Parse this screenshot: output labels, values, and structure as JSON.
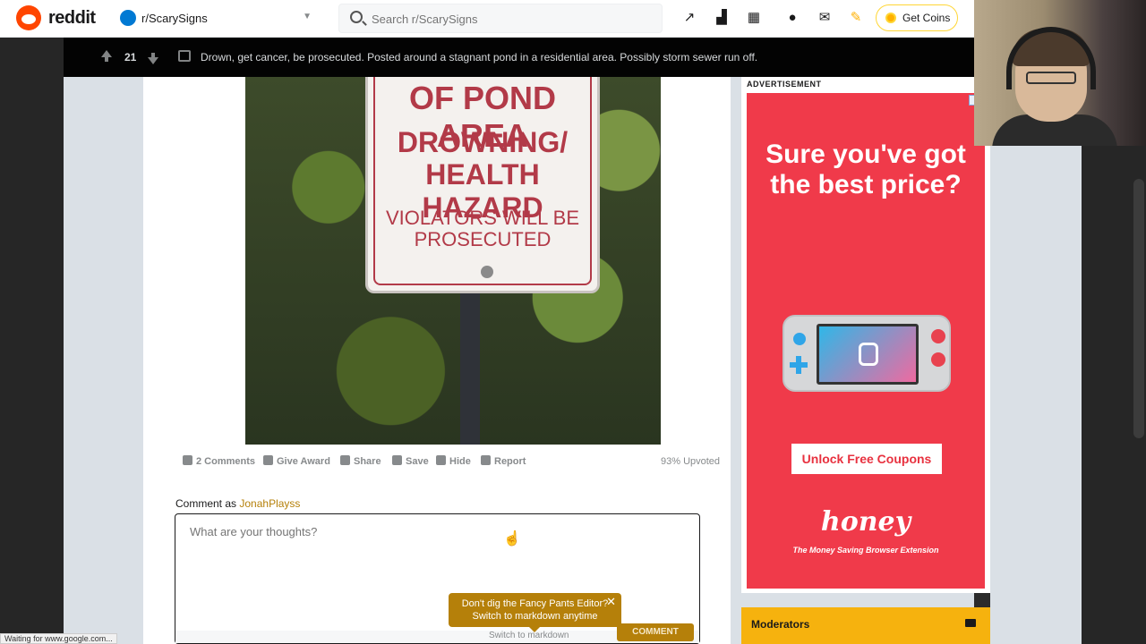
{
  "header": {
    "logo_text": "reddit",
    "subreddit": "r/ScarySigns",
    "search_placeholder": "Search r/ScarySigns",
    "get_coins": "Get Coins",
    "icons": [
      "trending-icon",
      "stats-icon",
      "qr-icon",
      "chat-icon",
      "mail-icon",
      "pencil-icon"
    ]
  },
  "post_bar": {
    "votes": "21",
    "title": "Drown, get cancer, be prosecuted. Posted around a stagnant pond in a residential area. Possibly storm sewer run off."
  },
  "sign": {
    "line1": "OF POND AREA",
    "line2": "DROWNING/",
    "line3": "HEALTH HAZARD",
    "line4": "VIOLATORS WILL BE",
    "line5": "PROSECUTED"
  },
  "actions": {
    "comments": "2 Comments",
    "award": "Give Award",
    "share": "Share",
    "save": "Save",
    "hide": "Hide",
    "report": "Report",
    "upvoted": "93% Upvoted"
  },
  "comment": {
    "as_label": "Comment as",
    "user": "JonahPlayss",
    "placeholder": "What are your thoughts?",
    "switch_markdown": "Switch to markdown",
    "button": "COMMENT",
    "tooltip_line1": "Don't dig the Fancy Pants Editor?",
    "tooltip_line2": "Switch to markdown anytime"
  },
  "ad": {
    "label": "ADVERTISEMENT",
    "headline": "Sure you've got the best price?",
    "cta": "Unlock Free Coupons",
    "brand": "honey",
    "tagline": "The Money Saving Browser Extension"
  },
  "moderators": {
    "title": "Moderators"
  },
  "status_bar": "Waiting for www.google.com...",
  "colors": {
    "reddit_orange": "#ff4500",
    "ad_red": "#f03a4a",
    "gold": "#b5800a",
    "moderators_bg": "#f6b20e"
  }
}
